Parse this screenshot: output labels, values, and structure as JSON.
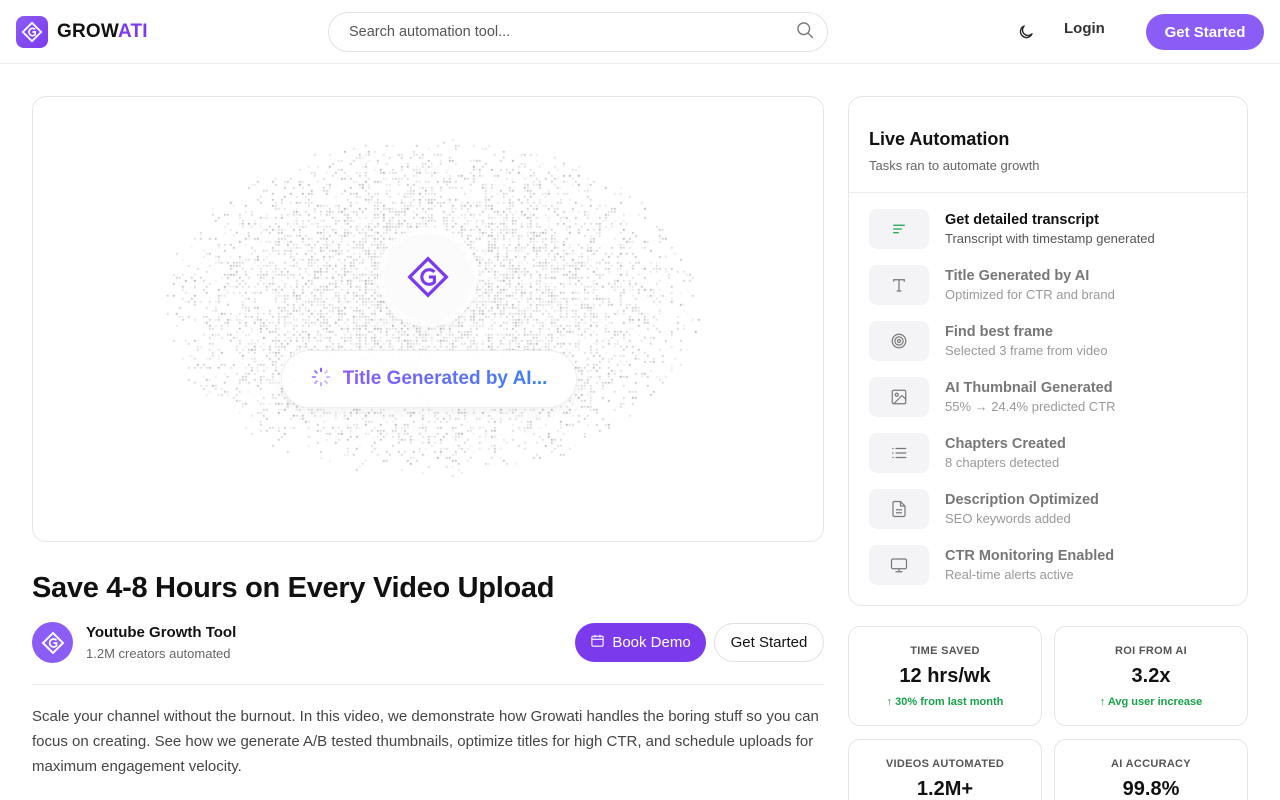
{
  "header": {
    "brand_part1": "GROW",
    "brand_part2": "ATI",
    "search_placeholder": "Search automation tool...",
    "login_label": "Login",
    "get_started_label": "Get Started"
  },
  "hero": {
    "status_text": "Title Generated by AI..."
  },
  "video": {
    "title": "Save 4-8 Hours on Every Video Upload",
    "channel_name": "Youtube Growth Tool",
    "channel_sub": "1.2M creators automated",
    "book_demo_label": "Book Demo",
    "get_started_label": "Get Started",
    "description": "Scale your channel without the burnout. In this video, we demonstrate how Growati handles the boring stuff so you can focus on creating. See how we generate A/B tested thumbnails, optimize titles for high CTR, and schedule uploads for maximum engagement velocity."
  },
  "automation": {
    "title": "Live Automation",
    "subtitle": "Tasks ran to automate growth",
    "tasks": [
      {
        "title": "Get detailed transcript",
        "sub": "Transcript with timestamp generated",
        "icon": "transcript-icon"
      },
      {
        "title": "Title Generated by AI",
        "sub": "Optimized for CTR and brand",
        "icon": "text-icon"
      },
      {
        "title": "Find best frame",
        "sub": "Selected 3 frame from video",
        "icon": "target-icon"
      },
      {
        "title": "AI Thumbnail Generated",
        "sub": "55% → 24.4% predicted CTR",
        "icon": "image-icon"
      },
      {
        "title": "Chapters Created",
        "sub": "8 chapters detected",
        "icon": "list-icon"
      },
      {
        "title": "Description Optimized",
        "sub": "SEO keywords added",
        "icon": "document-icon"
      },
      {
        "title": "CTR Monitoring Enabled",
        "sub": "Real-time alerts active",
        "icon": "monitor-icon"
      }
    ]
  },
  "stats": [
    {
      "label": "TIME SAVED",
      "value": "12 hrs/wk",
      "change": "↑ 30% from last month"
    },
    {
      "label": "ROI FROM AI",
      "value": "3.2x",
      "change": "↑ Avg user increase"
    },
    {
      "label": "VIDEOS AUTOMATED",
      "value": "1.2M+",
      "change": ""
    },
    {
      "label": "AI ACCURACY",
      "value": "99.8%",
      "change": ""
    }
  ],
  "colors": {
    "accent": "#8b5cf6",
    "accent_dark": "#7c3aed",
    "positive": "#16a34a"
  }
}
